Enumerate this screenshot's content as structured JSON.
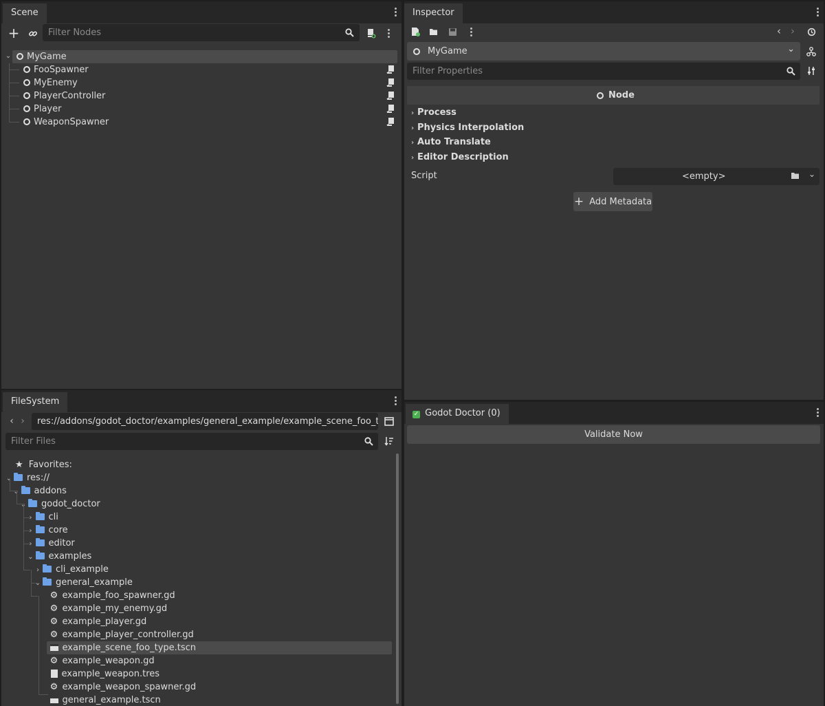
{
  "scene": {
    "tab": "Scene",
    "filter_placeholder": "Filter Nodes",
    "icons": [
      "add-node-icon",
      "link-icon",
      "search-icon",
      "attach-script-icon",
      "menu-icon"
    ],
    "nodes": [
      {
        "name": "MyGame",
        "root": true,
        "selected": true
      },
      {
        "name": "FooSpawner",
        "script": true
      },
      {
        "name": "MyEnemy",
        "script": true
      },
      {
        "name": "PlayerController",
        "script": true
      },
      {
        "name": "Player",
        "script": true
      },
      {
        "name": "WeaponSpawner",
        "script": true
      }
    ]
  },
  "filesystem": {
    "tab": "FileSystem",
    "path": "res://addons/godot_doctor/examples/general_example/example_scene_foo_type.tscn",
    "filter_placeholder": "Filter Files",
    "favorites": "Favorites:",
    "tree": [
      {
        "label": "res://",
        "type": "folder",
        "depth": 0,
        "expanded": true
      },
      {
        "label": "addons",
        "type": "folder",
        "depth": 1,
        "expanded": true
      },
      {
        "label": "godot_doctor",
        "type": "folder",
        "depth": 2,
        "expanded": true
      },
      {
        "label": "cli",
        "type": "folder",
        "depth": 3,
        "expanded": false
      },
      {
        "label": "core",
        "type": "folder",
        "depth": 3,
        "expanded": false
      },
      {
        "label": "editor",
        "type": "folder",
        "depth": 3,
        "expanded": false
      },
      {
        "label": "examples",
        "type": "folder",
        "depth": 3,
        "expanded": true
      },
      {
        "label": "cli_example",
        "type": "folder",
        "depth": 4,
        "expanded": false
      },
      {
        "label": "general_example",
        "type": "folder",
        "depth": 4,
        "expanded": true
      },
      {
        "label": "example_foo_spawner.gd",
        "type": "script",
        "depth": 5
      },
      {
        "label": "example_my_enemy.gd",
        "type": "script",
        "depth": 5
      },
      {
        "label": "example_player.gd",
        "type": "script",
        "depth": 5
      },
      {
        "label": "example_player_controller.gd",
        "type": "script",
        "depth": 5
      },
      {
        "label": "example_scene_foo_type.tscn",
        "type": "scene",
        "depth": 5,
        "selected": true
      },
      {
        "label": "example_weapon.gd",
        "type": "script",
        "depth": 5
      },
      {
        "label": "example_weapon.tres",
        "type": "resource",
        "depth": 5
      },
      {
        "label": "example_weapon_spawner.gd",
        "type": "script",
        "depth": 5
      },
      {
        "label": "general_example.tscn",
        "type": "scene",
        "depth": 5
      }
    ]
  },
  "inspector": {
    "tab": "Inspector",
    "object": "MyGame",
    "filter_placeholder": "Filter Properties",
    "section": "Node",
    "groups": [
      "Process",
      "Physics Interpolation",
      "Auto Translate",
      "Editor Description"
    ],
    "script_label": "Script",
    "script_value": "<empty>",
    "add_metadata": "Add Metadata"
  },
  "doctor": {
    "tab": "Godot Doctor (0)",
    "validate": "Validate Now"
  },
  "colors": {
    "panel": "#363636",
    "background": "#1e1e1e",
    "selection": "#4b4b4b",
    "folder": "#6ea2e8",
    "check": "#4caf50"
  }
}
